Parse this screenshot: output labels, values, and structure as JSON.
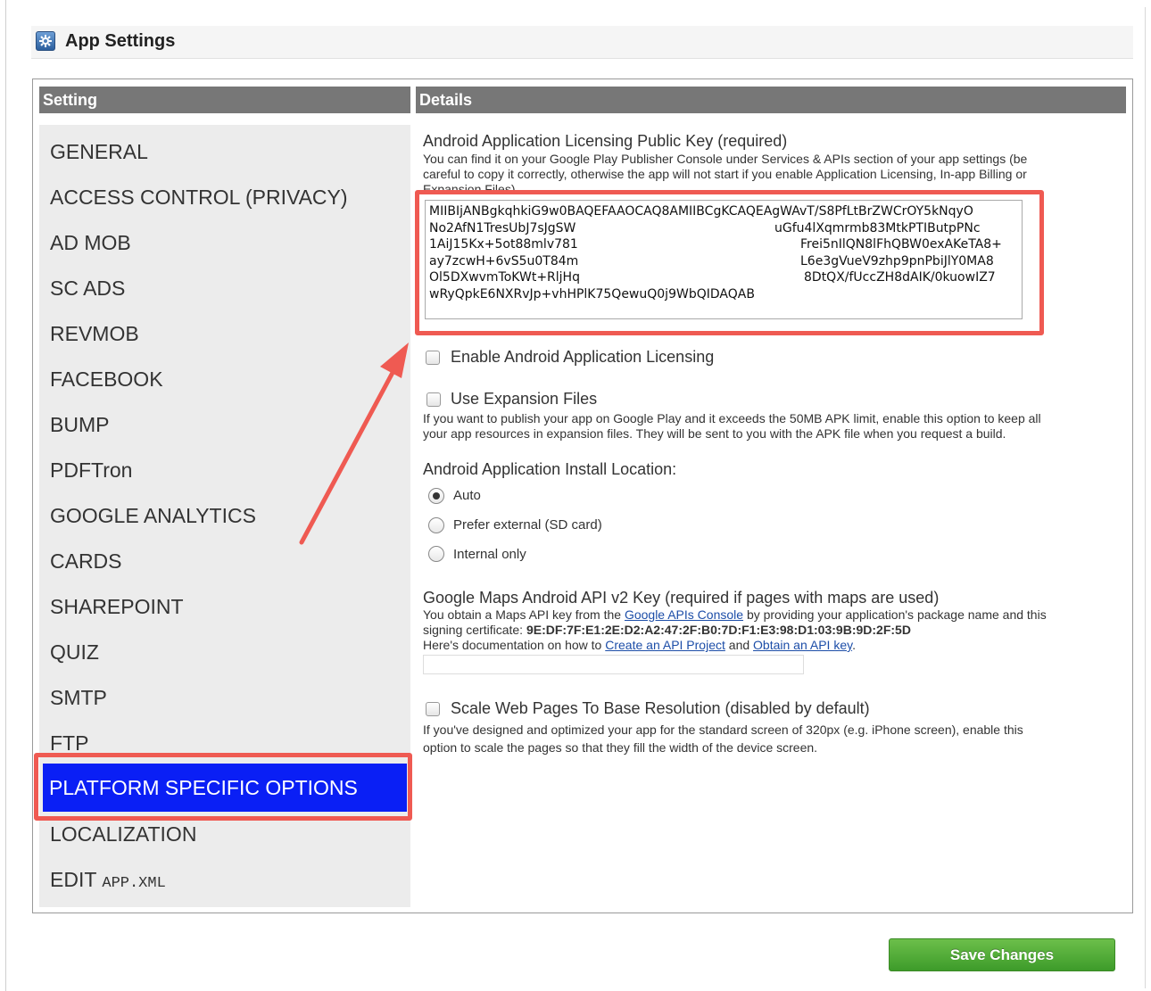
{
  "header": {
    "title": "App Settings",
    "icon": "settings-gear-icon"
  },
  "columns": {
    "setting": "Setting",
    "details": "Details"
  },
  "sidebar": {
    "items": [
      {
        "label": "GENERAL"
      },
      {
        "label": "ACCESS CONTROL (PRIVACY)"
      },
      {
        "label": "AD MOB"
      },
      {
        "label": "SC ADS"
      },
      {
        "label": "REVMOB"
      },
      {
        "label": "FACEBOOK"
      },
      {
        "label": "BUMP"
      },
      {
        "label": "PDFTron"
      },
      {
        "label": "GOOGLE ANALYTICS"
      },
      {
        "label": "CARDS"
      },
      {
        "label": "SHAREPOINT"
      },
      {
        "label": "QUIZ"
      },
      {
        "label": "SMTP"
      },
      {
        "label": "FTP"
      },
      {
        "label": "PLATFORM SPECIFIC OPTIONS"
      },
      {
        "label": "LOCALIZATION"
      }
    ],
    "edit_label": "EDIT",
    "edit_file": "APP.XML",
    "active_color": "#0a1ff5"
  },
  "details": {
    "licensing_key": {
      "title": "Android Application Licensing Public Key (required)",
      "help_line1": "You can find it on your Google Play Publisher Console under Services & APIs section of your app settings (be",
      "help_line2": "careful to copy it correctly, otherwise the app will not start if you enable Application Licensing, In-app Billing or",
      "help_line3": "Expansion Files)",
      "value_lines": [
        "MIIBIjANBgkqhkiG9w0BAQEFAAOCAQ8AMIIBCgKCAQEAgWAvT/S8PfLtBrZWCrOY5kNqyO",
        "No2AfN1TresUbJ7sJgSW",
        "1AiJ15Kx+5ot88mlv781",
        "ay7zcwH+6vS5u0T84m",
        "Ol5DXwvmToKWt+RljHq",
        "wRyQpkE6NXRvJp+vhHPlK75QewuQ0j9WbQIDAQAB"
      ],
      "value_right": [
        "",
        "uGfu4lXqmrmb83MtkPTIButpPNc",
        "Frei5nIlQN8lFhQBW0exAKeTA8+",
        "L6e3gVueV9zhp9pnPbiJlY0MA8",
        "8DtQX/fUccZH8dAIK/0kuowIZ7",
        ""
      ]
    },
    "enable_licensing": {
      "label": "Enable Android Application Licensing",
      "checked": false
    },
    "expansion_files": {
      "label": "Use Expansion Files",
      "checked": false,
      "help_line1": "If you want to publish your app on Google Play and it exceeds the 50MB APK limit, enable this option to keep all",
      "help_line2": "your app resources in expansion files. They will be sent to you with the APK file when you request a build."
    },
    "install_location": {
      "title": "Android Application Install Location:",
      "options": [
        "Auto",
        "Prefer external (SD card)",
        "Internal only"
      ],
      "selected": "Auto"
    },
    "maps_key": {
      "title": "Google Maps Android API v2 Key (required if pages with maps are used)",
      "help_a": "You obtain a Maps API key from the",
      "link_console": "Google APIs Console",
      "help_b": "by providing your application's package name and this",
      "help_c": "signing certificate:",
      "certificate": "9E:DF:7F:E1:2E:D2:A2:47:2F:B0:7D:F1:E3:98:D1:03:9B:9D:2F:5D",
      "help_d": "Here's documentation on how to",
      "link_project": "Create an API Project",
      "help_e": "and",
      "link_key": "Obtain an API key",
      "help_f": ".",
      "value": ""
    },
    "scale_pages": {
      "label": "Scale Web Pages To Base Resolution (disabled by default)",
      "checked": false,
      "help_line1": "If you've designed and optimized your app for the standard screen of 320px (e.g. iPhone screen), enable this",
      "help_line2": "option to scale the pages so that they fill the width of the device screen."
    }
  },
  "footer": {
    "save_label": "Save Changes"
  },
  "colors": {
    "highlight": "#ef5a52",
    "save": "#4fa934",
    "header_bar": "#777777"
  }
}
